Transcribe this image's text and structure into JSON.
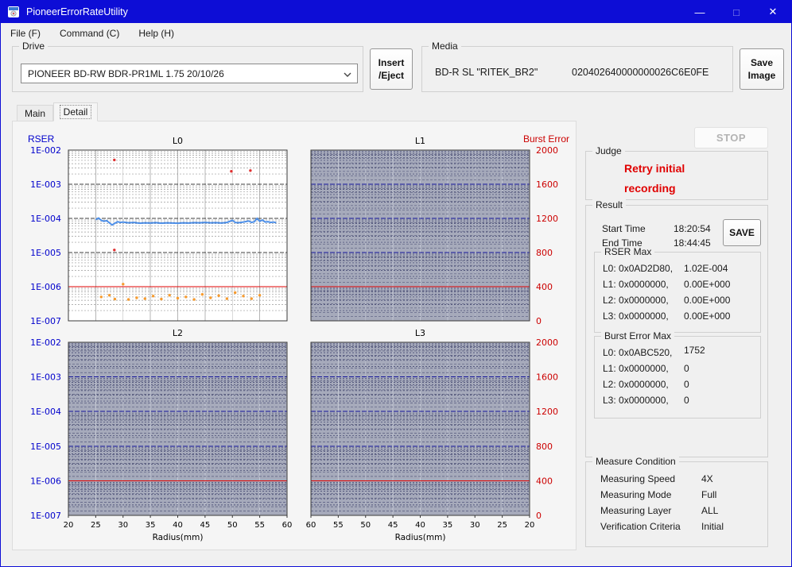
{
  "window": {
    "title": "PioneerErrorRateUtility",
    "controls": {
      "minimize": "—",
      "maximize": "□",
      "close": "✕"
    }
  },
  "menu": {
    "items": [
      "File (F)",
      "Command (C)",
      "Help (H)"
    ]
  },
  "toolbar": {
    "drive": {
      "label": "Drive",
      "value": "PIONEER BD-RW BDR-PR1ML 1.75 20/10/26"
    },
    "insert_eject": "Insert\n/Eject",
    "media": {
      "label": "Media",
      "type": "BD-R SL \"RITEK_BR2\"",
      "id": "020402640000000026C6E0FE"
    },
    "save_image": "Save\nImage"
  },
  "tabs": {
    "main": "Main",
    "detail": "Detail"
  },
  "axes": {
    "left_title": "RSER",
    "right_title": "Burst Error",
    "left_color": "#0000cc",
    "right_color": "#cc0000"
  },
  "chart_data": [
    {
      "type": "line",
      "title": "L0",
      "xlabel": "Radius(mm)",
      "x_ticks": [
        20,
        25,
        30,
        35,
        40,
        45,
        50,
        55,
        60
      ],
      "y_left_ticks": [
        "1E-002",
        "1E-003",
        "1E-004",
        "1E-005",
        "1E-006",
        "1E-007"
      ],
      "y_right_ticks": [
        "2000",
        "1600",
        "1200",
        "800",
        "400",
        "0"
      ],
      "left_log_range": [
        -2,
        -7
      ],
      "right_range": [
        2000,
        0
      ],
      "red_left_values": [
        1e-06
      ],
      "dense": false,
      "series": [
        {
          "name": "RSER",
          "axis": "left",
          "type": "line",
          "color": "#4d8fe8",
          "points": [
            [
              25,
              9.2e-05
            ],
            [
              25.5,
              0.000102
            ],
            [
              26,
              8.8e-05
            ],
            [
              26.5,
              8.2e-05
            ],
            [
              27,
              8.6e-05
            ],
            [
              27.5,
              7.4e-05
            ],
            [
              28,
              6.4e-05
            ],
            [
              28.5,
              7.2e-05
            ],
            [
              29,
              8e-05
            ],
            [
              29.5,
              7.6e-05
            ],
            [
              30,
              7.8e-05
            ],
            [
              31,
              7.4e-05
            ],
            [
              32,
              7.6e-05
            ],
            [
              33,
              7.2e-05
            ],
            [
              34,
              7.4e-05
            ],
            [
              35,
              7.3e-05
            ],
            [
              36,
              7.5e-05
            ],
            [
              37,
              7.2e-05
            ],
            [
              38,
              7.4e-05
            ],
            [
              39,
              7.3e-05
            ],
            [
              40,
              7.2e-05
            ],
            [
              41,
              7.4e-05
            ],
            [
              42,
              7.3e-05
            ],
            [
              43,
              7.5e-05
            ],
            [
              44,
              7.4e-05
            ],
            [
              45,
              7.6e-05
            ],
            [
              46,
              7.4e-05
            ],
            [
              47,
              7.5e-05
            ],
            [
              48,
              7.3e-05
            ],
            [
              49,
              7.6e-05
            ],
            [
              50,
              8.8e-05
            ],
            [
              50.5,
              7.6e-05
            ],
            [
              51,
              7.4e-05
            ],
            [
              52,
              7.8e-05
            ],
            [
              53,
              8.4e-05
            ],
            [
              53.5,
              7.6e-05
            ],
            [
              54,
              8e-05
            ],
            [
              54.5,
              0.0001
            ],
            [
              55,
              8.2e-05
            ],
            [
              55.5,
              9e-05
            ],
            [
              56,
              7.8e-05
            ],
            [
              56.5,
              8e-05
            ],
            [
              57,
              7.6e-05
            ],
            [
              57.5,
              7.8e-05
            ],
            [
              58,
              7.4e-05
            ]
          ]
        },
        {
          "name": "Burst Error",
          "axis": "right",
          "type": "scatter",
          "color": "#f79b2e",
          "points": [
            [
              26,
              280
            ],
            [
              27.5,
              300
            ],
            [
              28.5,
              255
            ],
            [
              30,
              430
            ],
            [
              31,
              250
            ],
            [
              32.5,
              270
            ],
            [
              34,
              260
            ],
            [
              35.5,
              290
            ],
            [
              37,
              255
            ],
            [
              38.5,
              300
            ],
            [
              40,
              265
            ],
            [
              41.5,
              280
            ],
            [
              43,
              250
            ],
            [
              44.5,
              310
            ],
            [
              46,
              270
            ],
            [
              47.5,
              295
            ],
            [
              49,
              260
            ],
            [
              50.5,
              330
            ],
            [
              52,
              290
            ],
            [
              53.5,
              260
            ],
            [
              55,
              300
            ]
          ]
        },
        {
          "name": "Burst Error Peak",
          "axis": "right",
          "type": "scatter",
          "color": "#e03030",
          "points": [
            [
              28.4,
              1885
            ],
            [
              28.4,
              830
            ],
            [
              49.8,
              1752
            ],
            [
              53.3,
              1760
            ]
          ]
        }
      ]
    },
    {
      "type": "line",
      "title": "L1",
      "xlabel": "Radius(mm)",
      "x_ticks": [
        60,
        55,
        50,
        45,
        40,
        35,
        30,
        25,
        20
      ],
      "y_left_ticks": [
        "1E-002",
        "1E-003",
        "1E-004",
        "1E-005",
        "1E-006",
        "1E-007"
      ],
      "y_right_ticks": [
        "2000",
        "1600",
        "1200",
        "800",
        "400",
        "0"
      ],
      "left_log_range": [
        -2,
        -7
      ],
      "right_range": [
        2000,
        0
      ],
      "red_left_values": [
        0.01,
        1e-06
      ],
      "dense": true,
      "series": []
    },
    {
      "type": "line",
      "title": "L2",
      "xlabel": "Radius(mm)",
      "x_ticks": [
        20,
        25,
        30,
        35,
        40,
        45,
        50,
        55,
        60
      ],
      "y_left_ticks": [
        "1E-002",
        "1E-003",
        "1E-004",
        "1E-005",
        "1E-006",
        "1E-007"
      ],
      "y_right_ticks": [
        "2000",
        "1600",
        "1200",
        "800",
        "400",
        "0"
      ],
      "left_log_range": [
        -2,
        -7
      ],
      "right_range": [
        2000,
        0
      ],
      "red_left_values": [
        0.01,
        1e-06
      ],
      "dense": true,
      "series": []
    },
    {
      "type": "line",
      "title": "L3",
      "xlabel": "Radius(mm)",
      "x_ticks": [
        60,
        55,
        50,
        45,
        40,
        35,
        30,
        25,
        20
      ],
      "y_left_ticks": [
        "1E-002",
        "1E-003",
        "1E-004",
        "1E-005",
        "1E-006",
        "1E-007"
      ],
      "y_right_ticks": [
        "2000",
        "1600",
        "1200",
        "800",
        "400",
        "0"
      ],
      "left_log_range": [
        -2,
        -7
      ],
      "right_range": [
        2000,
        0
      ],
      "red_left_values": [
        0.01,
        1e-06
      ],
      "dense": true,
      "series": []
    }
  ],
  "panel": {
    "stop": "STOP",
    "judge": {
      "label": "Judge",
      "text": "Retry initial recording",
      "color": "#e00000"
    },
    "result": {
      "label": "Result",
      "start_time_label": "Start Time",
      "start_time": "18:20:54",
      "end_time_label": "End Time",
      "end_time": "18:44:45",
      "save": "SAVE",
      "rser_max": {
        "label": "RSER Max",
        "rows": [
          {
            "label": "L0: 0x0AD2D80,",
            "value": "1.02E-004"
          },
          {
            "label": "L1: 0x0000000,",
            "value": "0.00E+000"
          },
          {
            "label": "L2: 0x0000000,",
            "value": "0.00E+000"
          },
          {
            "label": "L3: 0x0000000,",
            "value": "0.00E+000"
          }
        ]
      },
      "burst_max": {
        "label": "Burst Error Max",
        "rows": [
          {
            "label": "L0: 0x0ABC520,",
            "value": "1752"
          },
          {
            "label": "L1: 0x0000000,",
            "value": "0"
          },
          {
            "label": "L2: 0x0000000,",
            "value": "0"
          },
          {
            "label": "L3: 0x0000000,",
            "value": "0"
          }
        ]
      }
    },
    "measure": {
      "label": "Measure Condition",
      "rows": [
        {
          "label": "Measuring Speed",
          "value": "4X"
        },
        {
          "label": "Measuring Mode",
          "value": "Full"
        },
        {
          "label": "Measuring Layer",
          "value": "ALL"
        },
        {
          "label": "Verification Criteria",
          "value": "Initial"
        }
      ]
    }
  }
}
